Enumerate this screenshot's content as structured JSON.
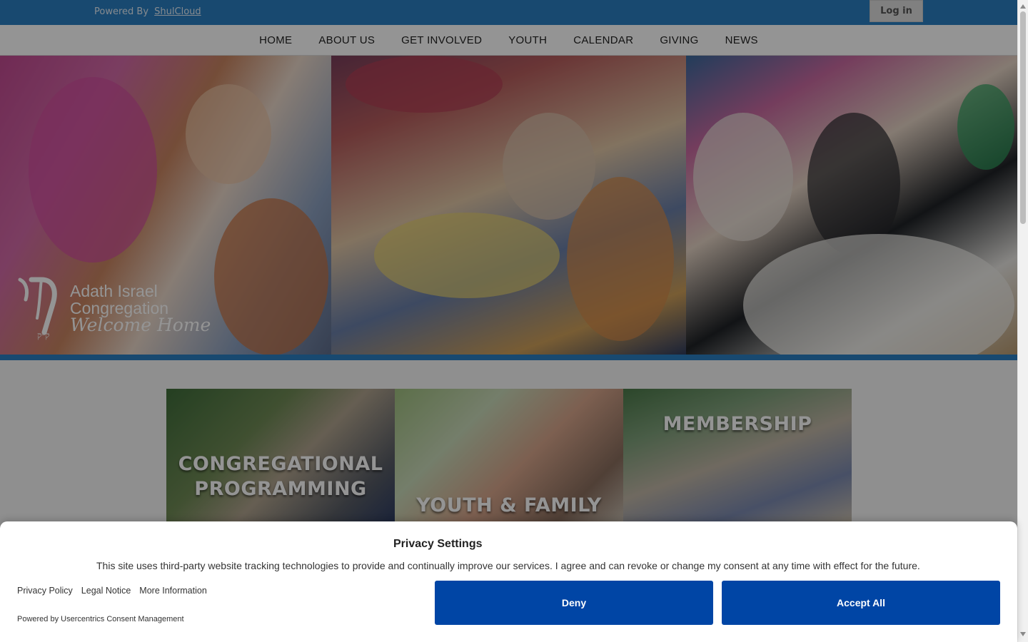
{
  "topbar": {
    "powered_prefix": "Powered By",
    "powered_link": "ShulCloud",
    "login_label": "Log in"
  },
  "nav": {
    "items": [
      "HOME",
      "ABOUT US",
      "GET INVOLVED",
      "YOUTH",
      "CALENDAR",
      "GIVING",
      "NEWS"
    ]
  },
  "hero": {
    "logo_line1": "Adath Israel",
    "logo_line2": "Congregation",
    "logo_tagline": "Welcome Home"
  },
  "tiles": [
    {
      "label_line1": "CONGREGATIONAL",
      "label_line2": "PROGRAMMING"
    },
    {
      "label_line1": "YOUTH & FAMILY",
      "label_line2": ""
    },
    {
      "label_line1": "MEMBERSHIP",
      "label_line2": ""
    }
  ],
  "consent": {
    "title": "Privacy Settings",
    "text": "This site uses third-party website tracking technologies to provide and continually improve our services. I agree and can revoke or change my consent at any time with effect for the future.",
    "links": [
      "Privacy Policy",
      "Legal Notice",
      "More Information"
    ],
    "powered": "Powered by Usercentrics Consent Management",
    "deny_label": "Deny",
    "accept_label": "Accept All"
  },
  "colors": {
    "brand_blue": "#2a7fc1",
    "button_blue": "#0045a5"
  }
}
